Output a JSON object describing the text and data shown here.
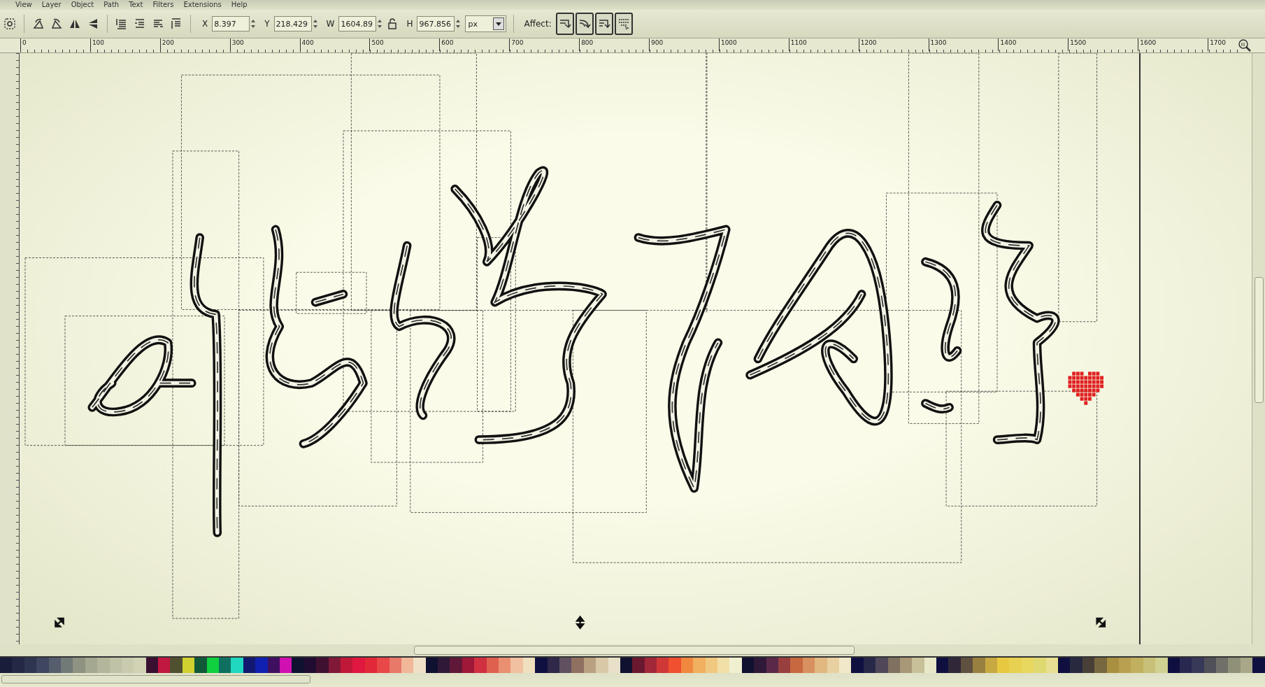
{
  "menu": [
    "View",
    "Layer",
    "Object",
    "Path",
    "Text",
    "Filters",
    "Extensions",
    "Help"
  ],
  "toolbar": {
    "fields": [
      {
        "label": "X",
        "value": "8.397"
      },
      {
        "label": "Y",
        "value": "218.429"
      },
      {
        "label": "W",
        "value": "1604.89"
      },
      {
        "label": "H",
        "value": "967.856"
      }
    ],
    "unit": "px",
    "affect_label": "Affect:",
    "affect_buttons": [
      {
        "on": true
      },
      {
        "on": true
      },
      {
        "on": true
      },
      {
        "on": true
      }
    ]
  },
  "ruler": {
    "labels": [
      "0",
      "100",
      "200",
      "300",
      "400",
      "500",
      "600",
      "700",
      "800",
      "900",
      "1000",
      "1100",
      "1200",
      "1300",
      "1400",
      "1500",
      "1600",
      "1700"
    ]
  },
  "palette": {
    "swatches": [
      {
        "color": "#1a1d3a"
      },
      {
        "color": "#232844"
      },
      {
        "color": "#2e3550"
      },
      {
        "color": "#3e4660"
      },
      {
        "color": "#565e6e"
      },
      {
        "color": "#727a78"
      },
      {
        "color": "#8e9280"
      },
      {
        "color": "#a5a890"
      },
      {
        "color": "#b4b69c"
      },
      {
        "color": "#c0c2a6"
      },
      {
        "color": "#cacbae"
      },
      {
        "color": "#d2d3b5"
      },
      {
        "color": "#3a1030"
      },
      {
        "color": "#c01840"
      },
      {
        "color": "#505030"
      },
      {
        "color": "#d0d030"
      },
      {
        "color": "#105838"
      },
      {
        "color": "#10d040"
      },
      {
        "color": "#107060"
      },
      {
        "color": "#20d8c0"
      },
      {
        "color": "#101870"
      },
      {
        "color": "#1020b0"
      },
      {
        "color": "#401060"
      },
      {
        "color": "#d010b0"
      },
      {
        "color": "#101030"
      },
      {
        "color": "#200c30"
      },
      {
        "color": "#401030"
      },
      {
        "color": "#801838"
      },
      {
        "color": "#c01838"
      },
      {
        "color": "#e01840"
      },
      {
        "color": "#e02838"
      },
      {
        "color": "#e84848"
      },
      {
        "color": "#e87868"
      },
      {
        "color": "#f0b898"
      },
      {
        "color": "#f0e0c8"
      },
      {
        "color": "#101030"
      },
      {
        "color": "#301838"
      },
      {
        "color": "#601838"
      },
      {
        "color": "#a01838"
      },
      {
        "color": "#d03040"
      },
      {
        "color": "#e06050"
      },
      {
        "color": "#e89070"
      },
      {
        "color": "#f0c0a0"
      },
      {
        "color": "#f0e0c0"
      },
      {
        "color": "#101040"
      },
      {
        "color": "#302848"
      },
      {
        "color": "#605060"
      },
      {
        "color": "#907060"
      },
      {
        "color": "#b8a080"
      },
      {
        "color": "#d8c8a8"
      },
      {
        "color": "#e8e0c8"
      },
      {
        "color": "#101030"
      },
      {
        "color": "#6a1830"
      },
      {
        "color": "#a02838"
      },
      {
        "color": "#d03838"
      },
      {
        "color": "#f05030"
      },
      {
        "color": "#f08840"
      },
      {
        "color": "#f0b060"
      },
      {
        "color": "#f0c880"
      },
      {
        "color": "#f0e0a8"
      },
      {
        "color": "#f0f0d0"
      },
      {
        "color": "#101030"
      },
      {
        "color": "#301838"
      },
      {
        "color": "#5a2848"
      },
      {
        "color": "#984040"
      },
      {
        "color": "#c86840"
      },
      {
        "color": "#d89060"
      },
      {
        "color": "#e0b880"
      },
      {
        "color": "#e8d0a0"
      },
      {
        "color": "#f0e8c8"
      },
      {
        "color": "#101040"
      },
      {
        "color": "#282848"
      },
      {
        "color": "#504858"
      },
      {
        "color": "#807060"
      },
      {
        "color": "#a89878"
      },
      {
        "color": "#c8c098"
      },
      {
        "color": "#e8e8c8"
      },
      {
        "color": "#101040"
      },
      {
        "color": "#302838"
      },
      {
        "color": "#605040"
      },
      {
        "color": "#988040"
      },
      {
        "color": "#c8a840"
      },
      {
        "color": "#e8c840"
      },
      {
        "color": "#e8d050"
      },
      {
        "color": "#e8d860"
      },
      {
        "color": "#e0d870"
      },
      {
        "color": "#e8e090"
      },
      {
        "color": "#101040"
      },
      {
        "color": "#282840"
      },
      {
        "color": "#484038"
      },
      {
        "color": "#786840"
      },
      {
        "color": "#a89040"
      },
      {
        "color": "#b8a050"
      },
      {
        "color": "#c0b060"
      },
      {
        "color": "#c8c078"
      },
      {
        "color": "#d0d090"
      },
      {
        "color": "#101040"
      },
      {
        "color": "#282850"
      },
      {
        "color": "#383858"
      },
      {
        "color": "#505058"
      },
      {
        "color": "#707068"
      },
      {
        "color": "#909078"
      },
      {
        "color": "#a8a888"
      },
      {
        "color": "#101040"
      }
    ]
  }
}
